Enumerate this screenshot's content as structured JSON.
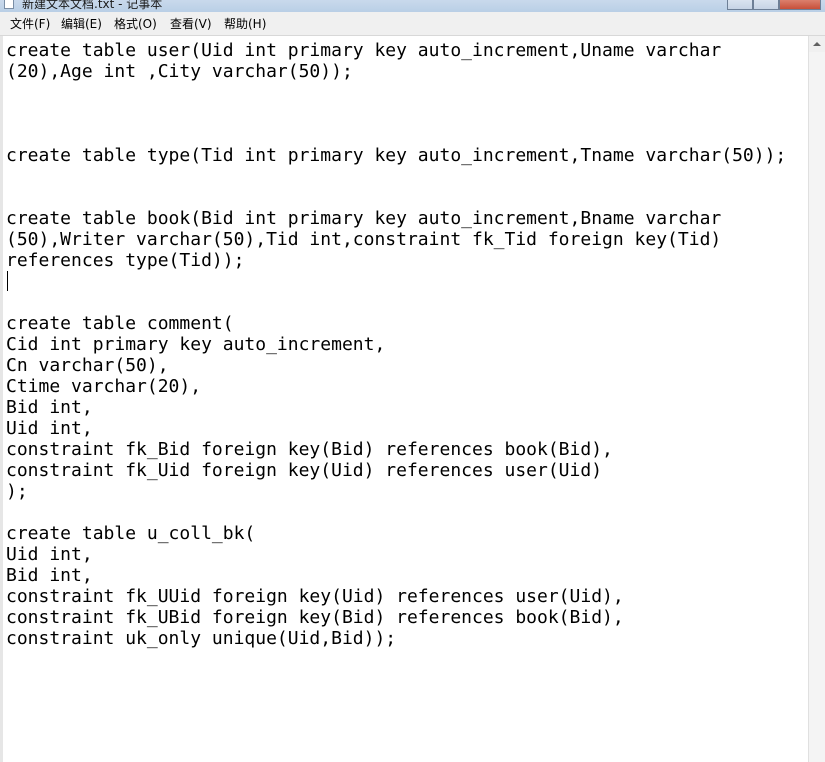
{
  "window": {
    "title": "新建文本文档.txt - 记事本"
  },
  "menu": [
    {
      "label": "文件(F)"
    },
    {
      "label": "编辑(E)"
    },
    {
      "label": "格式(O)"
    },
    {
      "label": "查看(V)"
    },
    {
      "label": "帮助(H)"
    }
  ],
  "editor": {
    "content": "create table user(Uid int primary key auto_increment,Uname varchar\n(20),Age int ,City varchar(50));\n\n\n\ncreate table type(Tid int primary key auto_increment,Tname varchar(50));\n\n\ncreate table book(Bid int primary key auto_increment,Bname varchar\n(50),Writer varchar(50),Tid int,constraint fk_Tid foreign key(Tid)\nreferences type(Tid));\n\n\ncreate table comment(\nCid int primary key auto_increment,\nCn varchar(50),\nCtime varchar(20),\nBid int,\nUid int,\nconstraint fk_Bid foreign key(Bid) references book(Bid),\nconstraint fk_Uid foreign key(Uid) references user(Uid)\n);\n\ncreate table u_coll_bk(\nUid int,\nBid int,\nconstraint fk_UUid foreign key(Uid) references user(Uid),\nconstraint fk_UBid foreign key(Bid) references book(Bid),\nconstraint uk_only unique(Uid,Bid));"
  },
  "icons": {
    "app": "notepad-icon",
    "scroll_up": "arrow-up-icon"
  }
}
